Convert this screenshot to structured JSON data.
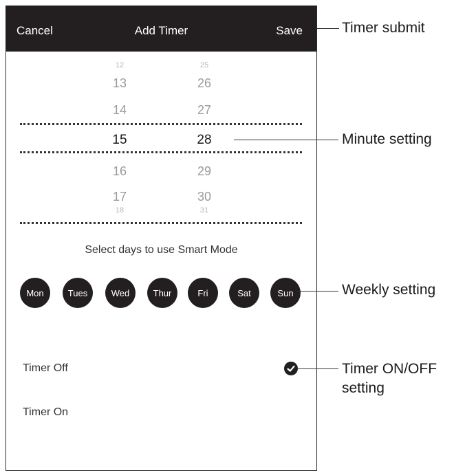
{
  "screen": {
    "header": {
      "cancel": "Cancel",
      "title": "Add Timer",
      "save": "Save"
    },
    "picker": {
      "hours": [
        "12",
        "13",
        "14",
        "15",
        "16",
        "17",
        "18"
      ],
      "minutes": [
        "25",
        "26",
        "27",
        "28",
        "29",
        "30",
        "31"
      ],
      "selected_hour": "15",
      "selected_minute": "28"
    },
    "days_label": "Select days to use Smart Mode",
    "days": [
      "Mon",
      "Tues",
      "Wed",
      "Thur",
      "Fri",
      "Sat",
      "Sun"
    ],
    "timer_off": "Timer Off",
    "timer_on": "Timer On"
  },
  "callouts": {
    "timer_submit": "Timer submit",
    "minute_setting": "Minute setting",
    "weekly_setting": "Weekly setting",
    "onoff_line1": "Timer ON/OFF",
    "onoff_line2": "setting"
  },
  "colors": {
    "bar": "#231f20",
    "accent": "#ffffff"
  }
}
